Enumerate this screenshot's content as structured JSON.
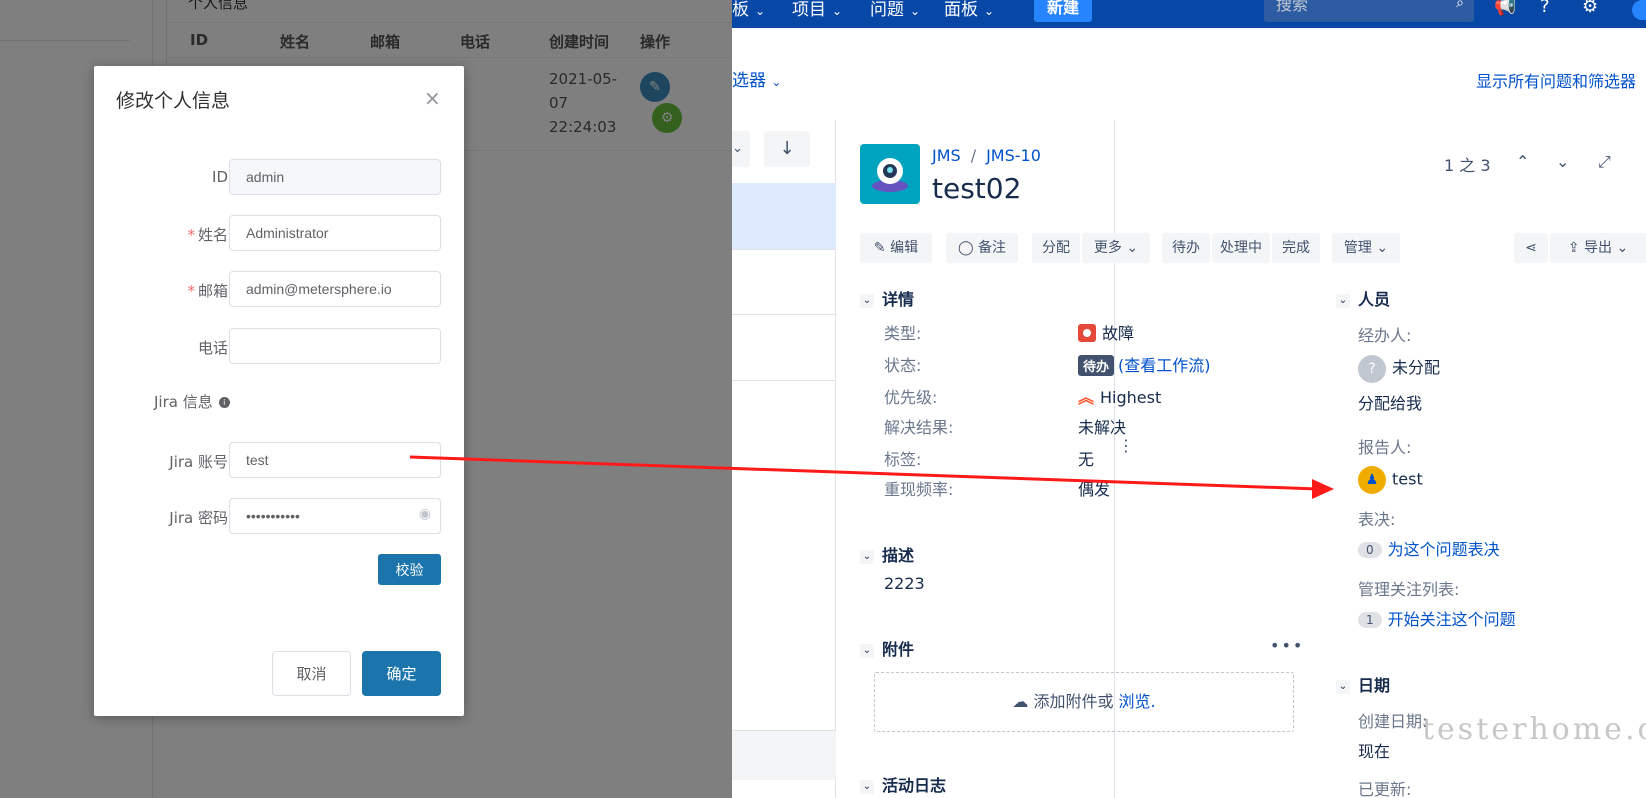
{
  "ms": {
    "card_title": "个人信息",
    "columns": [
      "ID",
      "姓名",
      "邮箱",
      "电话",
      "创建时间",
      "操作"
    ],
    "row": {
      "created_time": "2021-05-07 22:24:03"
    }
  },
  "dialog": {
    "title": "修改个人信息",
    "close": "×",
    "fields": {
      "id": {
        "label": "ID",
        "value": "admin"
      },
      "name": {
        "label": "姓名",
        "value": "Administrator"
      },
      "email": {
        "label": "邮箱",
        "value": "admin@metersphere.io"
      },
      "phone": {
        "label": "电话",
        "value": ""
      },
      "jira_info": {
        "label": "Jira 信息"
      },
      "jira_account": {
        "label": "Jira 账号",
        "value": "test"
      },
      "jira_password": {
        "label": "Jira 密码",
        "value": "•••••••••••"
      }
    },
    "verify": "校验",
    "cancel": "取消",
    "ok": "确定"
  },
  "jira": {
    "nav": {
      "boards_partial": "板",
      "projects": "项目",
      "issues": "问题",
      "dashboards": "面板",
      "create": "新建",
      "search_placeholder": "搜索"
    },
    "filter_left": "选器",
    "filter_right": "显示所有问题和筛选器",
    "issue": {
      "project": "JMS",
      "key": "JMS-10",
      "title": "test02",
      "pager": "1 之 3"
    },
    "toolbar": {
      "edit": "编辑",
      "comment": "备注",
      "assign": "分配",
      "more": "更多",
      "todo": "待办",
      "in_progress": "处理中",
      "done": "完成",
      "admin": "管理",
      "export": "导出"
    },
    "details": {
      "header": "详情",
      "type_label": "类型:",
      "type_value": "故障",
      "status_label": "状态:",
      "status_value": "待办",
      "workflow_link": "(查看工作流)",
      "priority_label": "优先级:",
      "priority_value": "Highest",
      "resolution_label": "解决结果:",
      "resolution_value": "未解决",
      "labels_label": "标签:",
      "labels_value": "无",
      "repro_label": "重现频率:",
      "repro_value": "偶发"
    },
    "description": {
      "header": "描述",
      "value": "2223"
    },
    "attachments": {
      "header": "附件",
      "drop_text": "添加附件或",
      "browse": "浏览."
    },
    "activity": {
      "header": "活动日志"
    },
    "people": {
      "header": "人员",
      "assignee_label": "经办人:",
      "assignee_value": "未分配",
      "assign_to_me": "分配给我",
      "reporter_label": "报告人:",
      "reporter_value": "test",
      "votes_label": "表决:",
      "votes_count": "0",
      "vote_link": "为这个问题表决",
      "watchers_label": "管理关注列表:",
      "watchers_count": "1",
      "watch_link": "开始关注这个问题"
    },
    "dates": {
      "header": "日期",
      "created_label": "创建日期:",
      "created_value": "现在",
      "updated_label": "已更新:"
    },
    "watermark": "testerhome.com"
  },
  "colors": {
    "jira_nav": "#0747a6",
    "ms_primary": "#1b74ab",
    "arrow": "#ff1a1a"
  }
}
